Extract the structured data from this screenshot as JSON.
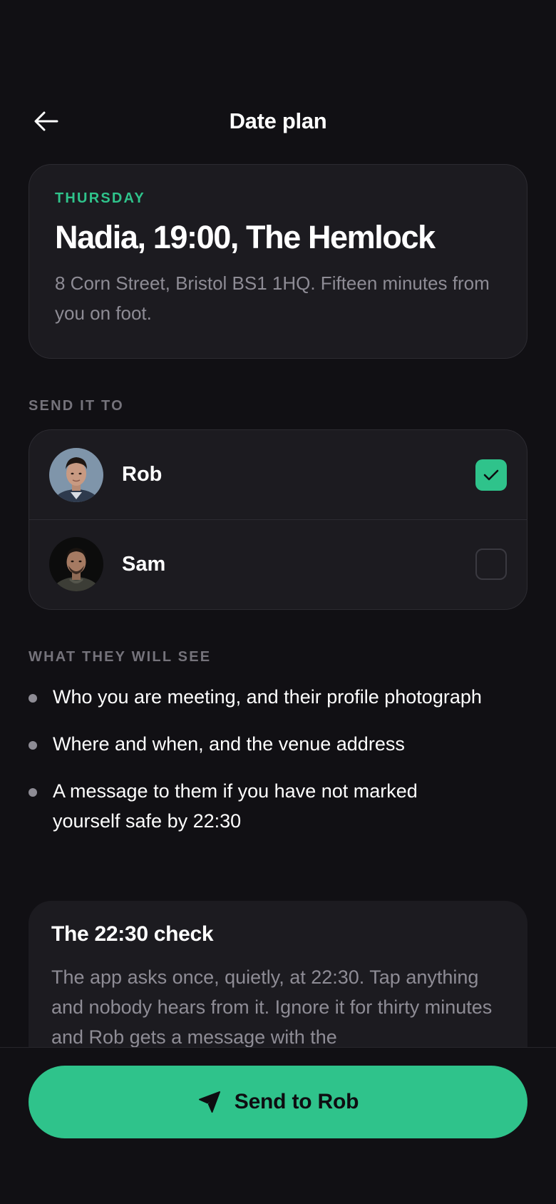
{
  "header": {
    "title": "Date plan",
    "back_icon": "arrow-left-icon"
  },
  "plan": {
    "day": "THURSDAY",
    "title": "Nadia, 19:00, The Hemlock",
    "description": "8 Corn Street, Bristol BS1 1HQ. Fifteen minutes from you on foot."
  },
  "send_section": {
    "label": "SEND IT TO",
    "contacts": [
      {
        "name": "Rob",
        "checked": true
      },
      {
        "name": "Sam",
        "checked": false
      }
    ]
  },
  "visibility_section": {
    "label": "WHAT THEY WILL SEE",
    "items": [
      "Who you are meeting, and their profile photograph",
      "Where and when, and the venue address",
      "A message to them if you have not marked yourself safe by 22:30"
    ]
  },
  "check_card": {
    "title": "The 22:30 check",
    "description": "The app asks once, quietly, at 22:30. Tap anything and nobody hears from it. Ignore it for thirty minutes and Rob gets a message with the"
  },
  "footer": {
    "send_label": "Send to Rob",
    "send_icon": "paper-plane-icon"
  },
  "colors": {
    "background": "#111014",
    "card": "#1c1b20",
    "accent": "#2fc38b",
    "muted_text": "#8e8c95",
    "label_text": "#75737b"
  }
}
